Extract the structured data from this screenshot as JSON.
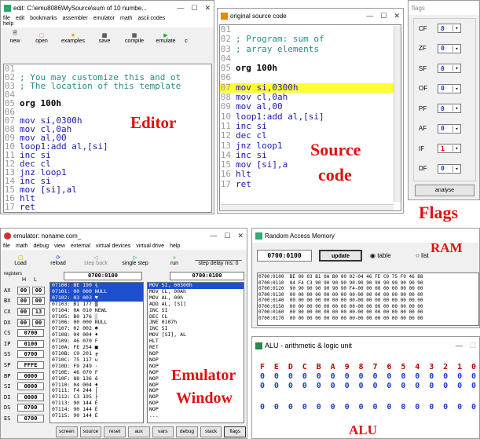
{
  "editor": {
    "title": "edit: C:\\emu8086\\MySource\\sum of 10 numbe...",
    "menu": [
      "file",
      "edit",
      "bookmarks",
      "assembler",
      "emulator",
      "math",
      "ascii codes",
      "help"
    ],
    "toolbar": [
      "new",
      "open",
      "examples",
      "save",
      "compile",
      "emulate",
      "c"
    ],
    "lines": [
      {
        "n": "01",
        "t": "",
        "c": "cm"
      },
      {
        "n": "02",
        "t": "; You may customize this and ot",
        "c": "cm"
      },
      {
        "n": "03",
        "t": "; The location of this template",
        "c": "cm"
      },
      {
        "n": "04",
        "t": "",
        "c": "cm"
      },
      {
        "n": "05",
        "t": "org 100h",
        "c": "lb"
      },
      {
        "n": "06",
        "t": "",
        "c": "cm"
      },
      {
        "n": "07",
        "t": "mov si,0300h",
        "c": "kw"
      },
      {
        "n": "08",
        "t": "mov cl,0ah",
        "c": "kw"
      },
      {
        "n": "09",
        "t": "mov al,00",
        "c": "kw"
      },
      {
        "n": "10",
        "t": "loop1:add al,[si]",
        "c": "kw"
      },
      {
        "n": "11",
        "t": "inc si",
        "c": "kw"
      },
      {
        "n": "12",
        "t": "dec cl",
        "c": "kw"
      },
      {
        "n": "13",
        "t": "jnz loop1",
        "c": "kw"
      },
      {
        "n": "14",
        "t": "inc si",
        "c": "kw"
      },
      {
        "n": "15",
        "t": "mov [si],al",
        "c": "kw"
      },
      {
        "n": "16",
        "t": "hlt",
        "c": "kw"
      },
      {
        "n": "17",
        "t": "ret",
        "c": "kw"
      }
    ],
    "label": "Editor"
  },
  "source": {
    "title": "original source code",
    "lines": [
      {
        "n": "01",
        "t": "",
        "c": "cm"
      },
      {
        "n": "02",
        "t": "; Program: sum of",
        "c": "cm"
      },
      {
        "n": "03",
        "t": "; array elements",
        "c": "cm"
      },
      {
        "n": "04",
        "t": "",
        "c": "cm"
      },
      {
        "n": "05",
        "t": "org 100h",
        "c": "lb"
      },
      {
        "n": "06",
        "t": "",
        "c": "cm"
      },
      {
        "n": "07",
        "t": "mov si,0300h",
        "c": "kw"
      },
      {
        "n": "08",
        "t": "mov cl,0ah",
        "c": "kw"
      },
      {
        "n": "09",
        "t": "mov al,00",
        "c": "kw"
      },
      {
        "n": "10",
        "t": "loop1:add al,[si]",
        "c": "kw"
      },
      {
        "n": "11",
        "t": "inc si",
        "c": "kw"
      },
      {
        "n": "12",
        "t": "dec cl",
        "c": "kw"
      },
      {
        "n": "13",
        "t": "jnz loop1",
        "c": "kw"
      },
      {
        "n": "14",
        "t": "inc si",
        "c": "kw"
      },
      {
        "n": "15",
        "t": "mov [si],a",
        "c": "kw"
      },
      {
        "n": "16",
        "t": "hlt",
        "c": "kw"
      },
      {
        "n": "17",
        "t": "ret",
        "c": "kw"
      }
    ],
    "label1": "Source",
    "label2": "code"
  },
  "flags": {
    "title": "flags",
    "items": [
      {
        "name": "CF",
        "val": "0"
      },
      {
        "name": "ZF",
        "val": "0"
      },
      {
        "name": "SF",
        "val": "0"
      },
      {
        "name": "OF",
        "val": "0"
      },
      {
        "name": "PF",
        "val": "0"
      },
      {
        "name": "AF",
        "val": "0"
      },
      {
        "name": "IF",
        "val": "1"
      },
      {
        "name": "DF",
        "val": "0"
      }
    ],
    "analyse": "analyse",
    "label": "Flags"
  },
  "emulator": {
    "title": "emulator: noname.com_",
    "menu": [
      "file",
      "math",
      "debug",
      "view",
      "external",
      "virtual devices",
      "virtual drive",
      "help"
    ],
    "toolbar": [
      "Load",
      "reload",
      "step back",
      "single step",
      "run",
      "step delay ms: 0"
    ],
    "registers_label": "registers",
    "h": "H",
    "l": "L",
    "addr1": "0700:0100",
    "addr2": "0700:0100",
    "regs": [
      {
        "n": "AX",
        "h": "00",
        "l": "00"
      },
      {
        "n": "BX",
        "h": "00",
        "l": "00"
      },
      {
        "n": "CX",
        "h": "00",
        "l": "13"
      },
      {
        "n": "DX",
        "h": "00",
        "l": "00"
      },
      {
        "n": "CS",
        "v": "0700"
      },
      {
        "n": "IP",
        "v": "0100"
      },
      {
        "n": "SS",
        "v": "0700"
      },
      {
        "n": "SP",
        "v": "FFFE"
      },
      {
        "n": "BP",
        "v": "0000"
      },
      {
        "n": "SI",
        "v": "0000"
      },
      {
        "n": "DI",
        "v": "0000"
      },
      {
        "n": "DS",
        "v": "0700"
      },
      {
        "n": "ES",
        "v": "0700"
      }
    ],
    "mem": [
      "07100: BE 190 ¾",
      "07101: 00 000 NULL",
      "07102: 03 003 ♥",
      "07103: B1 177 ▒",
      "07104: 0A 010 NEWL",
      "07105: B0 176 ░",
      "07106: 00 000 NULL",
      "07107: 02 002 ☻",
      "07108: 04 004 ♦",
      "07109: 46 070 F",
      "0710A: FE 254 ■",
      "0710B: C9 201 ╔",
      "0710C: 75 117 u",
      "0710D: F9 249 ·",
      "0710E: 46 070 F",
      "0710F: 88 136 ê",
      "07110: 04 004 ♦",
      "07111: F4 244 ⌠",
      "07112: C3 195 ├",
      "07113: 90 144 É",
      "07114: 90 144 É",
      "07115: 90 144 É"
    ],
    "dis": [
      "MOV SI, 00300h",
      "MOV CL, 00Ah",
      "MOV AL, 00h",
      "ADD AL, [SI]",
      "INC SI",
      "DEC CL",
      "JNE 0107h",
      "INC SI",
      "MOV [SI], AL",
      "HLT",
      "RET",
      "NOP",
      "NOP",
      "NOP",
      "NOP",
      "NOP",
      "NOP",
      "NOP",
      "NOP",
      "NOP",
      "NOP",
      "..."
    ],
    "bottom": [
      "screen",
      "source",
      "reset",
      "aux",
      "vars",
      "debug",
      "stack",
      "flags"
    ],
    "label1": "Emulator",
    "label2": "Window"
  },
  "ram": {
    "title": "Random Access Memory",
    "addr": "0700:0100",
    "update": "update",
    "table": "table",
    "list": "list",
    "label": "RAM",
    "rows": [
      "0700:0100  BE 00 03 B1 0A B0 00 02-04 46 FE C9 75 F9 46 88",
      "0700:0110  04 F4 C3 90 90 90 90 90-90 90 90 90 90 90 90 90",
      "0700:0120  90 90 90 90 90 90 90 F4-00 00 00 00 00 00 00 00",
      "0700:0130  00 00 00 00 00 00 00 00-00 00 00 00 00 00 00 00",
      "0700:0140  00 00 00 00 00 00 00 00-00 00 00 00 00 00 00 00",
      "0700:0150  00 00 00 00 00 00 00 00-00 00 00 00 00 00 00 00",
      "0700:0160  00 00 00 00 00 00 00 00-00 00 00 00 00 00 00 00",
      "0700:0170  00 00 00 00 00 00 00 00-00 00 00 00 00 00 00 00"
    ]
  },
  "alu": {
    "title": "ALU - arithmetic & logic unit",
    "hex": [
      "F",
      "E",
      "D",
      "C",
      "B",
      "A",
      "9",
      "8",
      "7",
      "6",
      "5",
      "4",
      "3",
      "2",
      "1",
      "0"
    ],
    "row1": [
      "0",
      "0",
      "0",
      "0",
      "0",
      "0",
      "0",
      "0",
      "0",
      "0",
      "0",
      "0",
      "0",
      "0",
      "0",
      "0"
    ],
    "row2": [
      "0",
      "0",
      "0",
      "0",
      "0",
      "0",
      "0",
      "0",
      "0",
      "0",
      "0",
      "0",
      "0",
      "0",
      "0",
      "0"
    ],
    "row3": [
      "0",
      "0",
      "0",
      "0",
      "0",
      "0",
      "0",
      "0",
      "0",
      "0",
      "0",
      "0",
      "0",
      "0",
      "0",
      "0"
    ],
    "label": "ALU"
  }
}
